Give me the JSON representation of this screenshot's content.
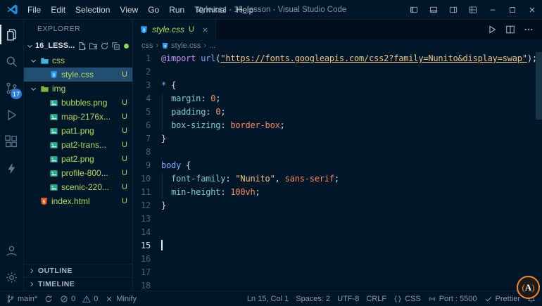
{
  "colors": {
    "git_green": "#addb67",
    "accent_blue": "#2d7ad2",
    "selection_bg": "#234d70"
  },
  "title_bar": {
    "menus": [
      "File",
      "Edit",
      "Selection",
      "View",
      "Go",
      "Run",
      "Terminal",
      "Help"
    ],
    "title": "style.css - 16_lesson - Visual Studio Code"
  },
  "activity_bar": {
    "items": [
      {
        "id": "explorer",
        "active": true
      },
      {
        "id": "search"
      },
      {
        "id": "source-control",
        "badge": "17"
      },
      {
        "id": "run-debug"
      },
      {
        "id": "extensions"
      },
      {
        "id": "thunder-client"
      }
    ],
    "bottom": [
      {
        "id": "account"
      },
      {
        "id": "settings"
      }
    ]
  },
  "sidebar": {
    "title": "EXPLORER",
    "project": "16_LESS...",
    "sections": [
      "OUTLINE",
      "TIMELINE"
    ],
    "tree": [
      {
        "type": "folder",
        "label": "css",
        "icon": "folder",
        "color": "#49b3d6",
        "indent": 1
      },
      {
        "type": "file",
        "label": "style.css",
        "icon": "css",
        "badge": "U",
        "selected": true,
        "indent": 2
      },
      {
        "type": "folder",
        "label": "img",
        "icon": "folder",
        "color": "#7cb342",
        "indent": 1
      },
      {
        "type": "file",
        "label": "bubbles.png",
        "icon": "image",
        "badge": "U",
        "indent": 2
      },
      {
        "type": "file",
        "label": "map-2176x...",
        "icon": "image",
        "badge": "U",
        "indent": 2
      },
      {
        "type": "file",
        "label": "pat1.png",
        "icon": "image",
        "badge": "U",
        "indent": 2
      },
      {
        "type": "file",
        "label": "pat2-trans...",
        "icon": "image",
        "badge": "U",
        "indent": 2
      },
      {
        "type": "file",
        "label": "pat2.png",
        "icon": "image",
        "badge": "U",
        "indent": 2
      },
      {
        "type": "file",
        "label": "profile-800...",
        "icon": "image",
        "badge": "U",
        "indent": 2
      },
      {
        "type": "file",
        "label": "scenic-220...",
        "icon": "image",
        "badge": "U",
        "indent": 2
      },
      {
        "type": "file",
        "label": "index.html",
        "icon": "html",
        "badge": "U",
        "indent": 1
      }
    ]
  },
  "editor": {
    "tab": {
      "label": "style.css",
      "badge": "U"
    },
    "breadcrumbs": [
      {
        "label": "css"
      },
      {
        "label": "style.css",
        "icon": "css"
      },
      {
        "label": "..."
      }
    ],
    "cursor_line": 15,
    "token_colors": {
      "keyword": "#c792ea",
      "fn": "#82aaff",
      "string": "#ecc48d",
      "punct": "#d6deeb",
      "selector": "#82aaff",
      "prop": "#80cbc4",
      "number": "#f78c6c",
      "value": "#f78c6c",
      "plain": "#d6deeb"
    },
    "lines": [
      [
        {
          "t": "@import",
          "c": "keyword"
        },
        {
          "t": " ",
          "c": "plain"
        },
        {
          "t": "url",
          "c": "fn"
        },
        {
          "t": "(",
          "c": "punct"
        },
        {
          "t": "\"https://fonts.googleapis.com/css2?family=Nunito&display=swap\"",
          "c": "string",
          "u": true
        },
        {
          "t": ");",
          "c": "punct"
        }
      ],
      [],
      [
        {
          "t": "* ",
          "c": "selector"
        },
        {
          "t": "{",
          "c": "punct"
        }
      ],
      [
        {
          "t": "  ",
          "c": "plain"
        },
        {
          "t": "margin",
          "c": "prop"
        },
        {
          "t": ": ",
          "c": "punct"
        },
        {
          "t": "0",
          "c": "number"
        },
        {
          "t": ";",
          "c": "punct"
        }
      ],
      [
        {
          "t": "  ",
          "c": "plain"
        },
        {
          "t": "padding",
          "c": "prop"
        },
        {
          "t": ": ",
          "c": "punct"
        },
        {
          "t": "0",
          "c": "number"
        },
        {
          "t": ";",
          "c": "punct"
        }
      ],
      [
        {
          "t": "  ",
          "c": "plain"
        },
        {
          "t": "box-sizing",
          "c": "prop"
        },
        {
          "t": ": ",
          "c": "punct"
        },
        {
          "t": "border-box",
          "c": "value"
        },
        {
          "t": ";",
          "c": "punct"
        }
      ],
      [
        {
          "t": "}",
          "c": "punct"
        }
      ],
      [],
      [
        {
          "t": "body ",
          "c": "selector"
        },
        {
          "t": "{",
          "c": "punct"
        }
      ],
      [
        {
          "t": "  ",
          "c": "plain"
        },
        {
          "t": "font-family",
          "c": "prop"
        },
        {
          "t": ": ",
          "c": "punct"
        },
        {
          "t": "\"Nunito\"",
          "c": "string"
        },
        {
          "t": ", ",
          "c": "punct"
        },
        {
          "t": "sans-serif",
          "c": "value"
        },
        {
          "t": ";",
          "c": "punct"
        }
      ],
      [
        {
          "t": "  ",
          "c": "plain"
        },
        {
          "t": "min-height",
          "c": "prop"
        },
        {
          "t": ": ",
          "c": "punct"
        },
        {
          "t": "100vh",
          "c": "number"
        },
        {
          "t": ";",
          "c": "punct"
        }
      ],
      [
        {
          "t": "}",
          "c": "punct"
        }
      ],
      [],
      [],
      [],
      [],
      [],
      []
    ]
  },
  "status_bar": {
    "left": [
      {
        "name": "git-branch",
        "icon": "branch",
        "label": "main*"
      },
      {
        "name": "sync-changes",
        "icon": "sync",
        "label": ""
      },
      {
        "name": "problems-errors",
        "icon": "error",
        "label": "0"
      },
      {
        "name": "problems-warnings",
        "icon": "warning",
        "label": "0"
      },
      {
        "name": "minify",
        "icon": "close",
        "label": "Minify"
      }
    ],
    "right": [
      {
        "name": "cursor-position",
        "label": "Ln 15, Col 1"
      },
      {
        "name": "indentation",
        "label": "Spaces: 2"
      },
      {
        "name": "encoding",
        "label": "UTF-8"
      },
      {
        "name": "eol-sequence",
        "label": "CRLF"
      },
      {
        "name": "language-mode",
        "icon": "braces",
        "label": "CSS"
      },
      {
        "name": "live-server-port",
        "icon": "broadcast",
        "label": "Port : 5500"
      },
      {
        "name": "prettier",
        "icon": "check",
        "label": "Prettier"
      },
      {
        "name": "notifications",
        "icon": "bell",
        "label": ""
      }
    ]
  },
  "watermark": {
    "letter": "A"
  }
}
